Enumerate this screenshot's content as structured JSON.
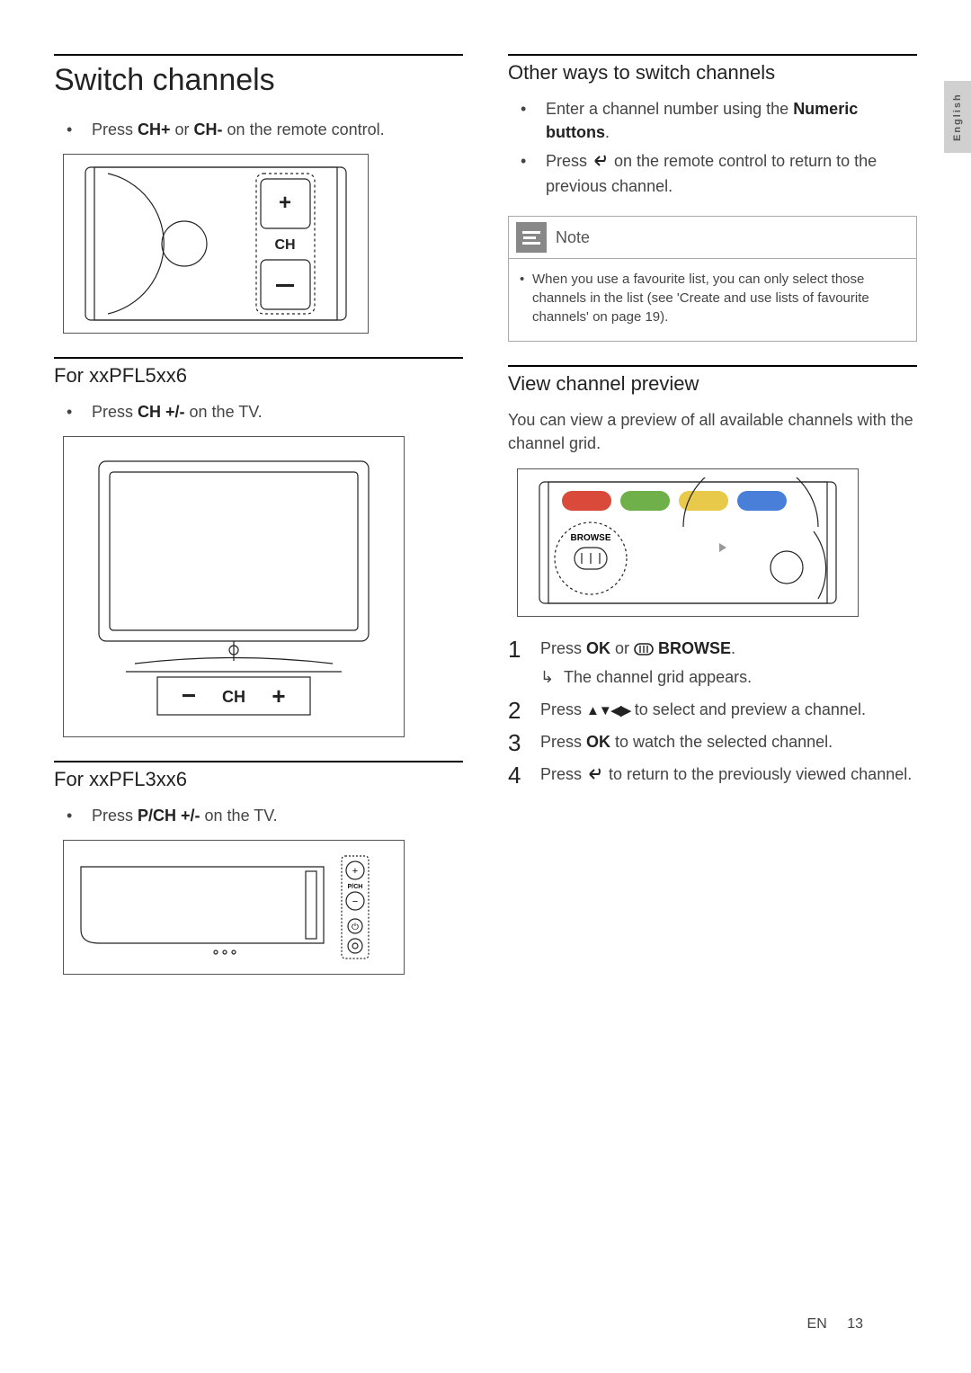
{
  "lang_tab": "English",
  "left": {
    "h1": "Switch channels",
    "bullet1_pre": "Press ",
    "bullet1_b1": "CH+",
    "bullet1_mid": " or ",
    "bullet1_b2": "CH-",
    "bullet1_post": " on the remote control.",
    "sec2_h": "For xxPFL5xx6",
    "sec2_bullet_pre": "Press ",
    "sec2_bullet_b": "CH +/-",
    "sec2_bullet_post": " on the TV.",
    "sec3_h": "For xxPFL3xx6",
    "sec3_bullet_pre": "Press ",
    "sec3_bullet_b": "P/CH +/-",
    "sec3_bullet_post": " on the TV."
  },
  "right": {
    "h2a": "Other ways to switch channels",
    "ra_b1_pre": "Enter a channel number using the ",
    "ra_b1_bold": "Numeric buttons",
    "ra_b1_post": ".",
    "ra_b2_pre": "Press ",
    "ra_b2_post": " on the remote control to return to the previous channel.",
    "note_title": "Note",
    "note_body": "When you use a favourite list, you can only select those channels in the list (see 'Create and use lists of favourite channels' on page 19).",
    "h2b": "View channel preview",
    "vcp_intro": "You can view a preview of all available channels with the channel grid.",
    "step1_pre": "Press ",
    "step1_b1": "OK",
    "step1_mid": " or ",
    "step1_b2": " BROWSE",
    "step1_post": ".",
    "step1_result": "The channel grid appears.",
    "step2_pre": "Press ",
    "step2_post": " to select and preview a channel.",
    "step3_pre": "Press ",
    "step3_b": "OK",
    "step3_post": " to watch the selected channel.",
    "step4_pre": "Press ",
    "step4_post": " to return to the previously viewed channel."
  },
  "footer": {
    "lang": "EN",
    "page": "13"
  },
  "figure_labels": {
    "ch": "CH",
    "browse": "BROWSE",
    "pch": "P/CH"
  }
}
